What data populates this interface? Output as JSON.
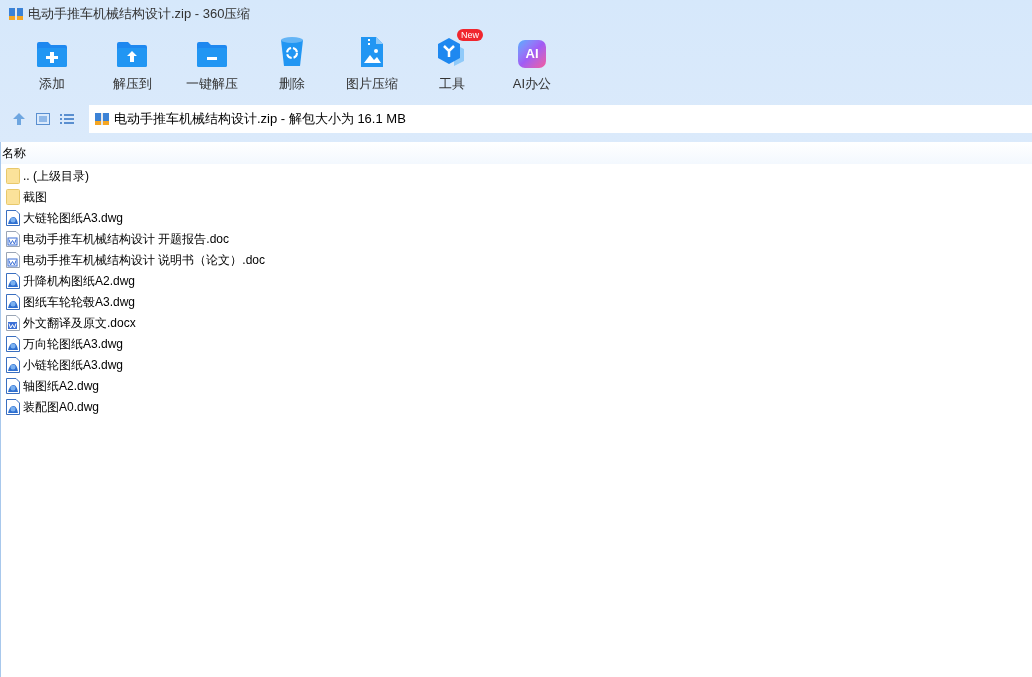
{
  "window": {
    "title": "电动手推车机械结构设计.zip - 360压缩"
  },
  "toolbar": [
    {
      "kind": "add",
      "label": "添加"
    },
    {
      "kind": "extract",
      "label": "解压到"
    },
    {
      "kind": "oneclick",
      "label": "一键解压"
    },
    {
      "kind": "delete",
      "label": "删除"
    },
    {
      "kind": "image",
      "label": "图片压缩"
    },
    {
      "kind": "tools",
      "label": "工具",
      "badge": "New"
    },
    {
      "kind": "ai",
      "label": "AI办公",
      "icon_text": "AI"
    }
  ],
  "address_bar": {
    "path": "电动手推车机械结构设计.zip - 解包大小为 16.1 MB"
  },
  "file_list": {
    "columns": [
      "名称"
    ],
    "rows": [
      {
        "kind": "folder",
        "name": ".. (上级目录)"
      },
      {
        "kind": "folder",
        "name": "截图"
      },
      {
        "kind": "dwg",
        "name": "大链轮图纸A3.dwg"
      },
      {
        "kind": "doc",
        "name": "电动手推车机械结构设计 开题报告.doc"
      },
      {
        "kind": "doc",
        "name": "电动手推车机械结构设计 说明书（论文）.doc"
      },
      {
        "kind": "dwg",
        "name": "升降机构图纸A2.dwg"
      },
      {
        "kind": "dwg",
        "name": "图纸车轮轮毂A3.dwg"
      },
      {
        "kind": "docx",
        "name": "外文翻译及原文.docx"
      },
      {
        "kind": "dwg",
        "name": "万向轮图纸A3.dwg"
      },
      {
        "kind": "dwg",
        "name": "小链轮图纸A3.dwg"
      },
      {
        "kind": "dwg",
        "name": "轴图纸A2.dwg"
      },
      {
        "kind": "dwg",
        "name": "装配图A0.dwg"
      }
    ]
  }
}
